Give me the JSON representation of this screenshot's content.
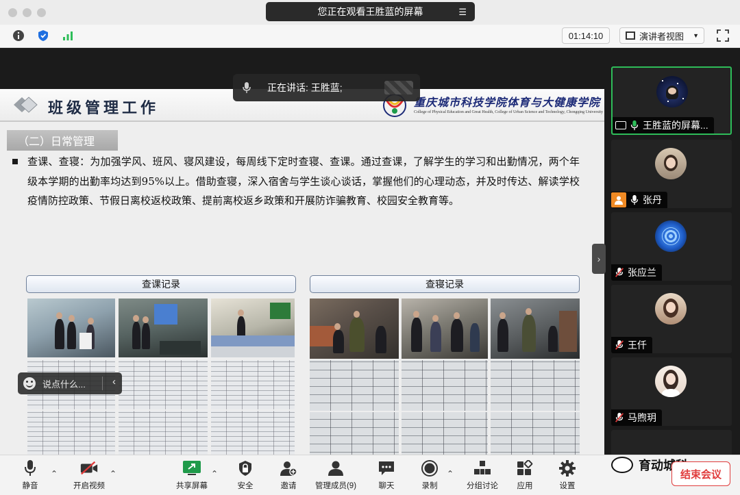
{
  "window": {
    "sharing_banner": "您正在观看王胜蓝的屏幕",
    "timer": "01:14:10",
    "view_mode": "演讲者视图"
  },
  "speaking": {
    "label": "正在讲话: 王胜蓝;"
  },
  "slide": {
    "title": "班级管理工作",
    "college_name": "重庆城市科技学院体育与大健康学院",
    "college_sub": "College of Physical Education and Great Health, College of Urban Science and Technology, Chongqing University",
    "section": "（二）日常管理",
    "paragraph": "查课、查寝：为加强学风、班风、寝风建设，每周线下定时查寝、查课。通过查课，了解学生的学习和出勤情况，两个年级本学期的出勤率均达到95%以上。借助查寝，深入宿舍与学生谈心谈话，掌握他们的心理动态，并及时传达、解读学校疫情防控政策、节假日离校返校政策、提前离校返乡政策和开展防诈骗教育、校园安全教育等。",
    "caption_left": "查课记录",
    "caption_right": "查寝记录"
  },
  "chat": {
    "placeholder": "说点什么..."
  },
  "participants": [
    {
      "name": "王胜蓝的屏幕...",
      "mic": "on",
      "badge": "share"
    },
    {
      "name": "张丹",
      "mic": "on",
      "badge": "person"
    },
    {
      "name": "张应兰",
      "mic": "muted"
    },
    {
      "name": "王仟",
      "mic": "muted"
    },
    {
      "name": "马煦玥",
      "mic": "muted"
    }
  ],
  "controls": {
    "mute": "静音",
    "video": "开启视频",
    "share": "共享屏幕",
    "security": "安全",
    "invite": "邀请",
    "members": "管理成员(9)",
    "chat": "聊天",
    "record": "录制",
    "breakout": "分组讨论",
    "apps": "应用",
    "settings": "设置",
    "end": "结束会议"
  },
  "watermark": "育动城科",
  "colors": {
    "active_speaker": "#2ebd59",
    "end_button": "#e03b3b",
    "badge_orange": "#f08a24",
    "title_navy": "#1e2b44"
  }
}
